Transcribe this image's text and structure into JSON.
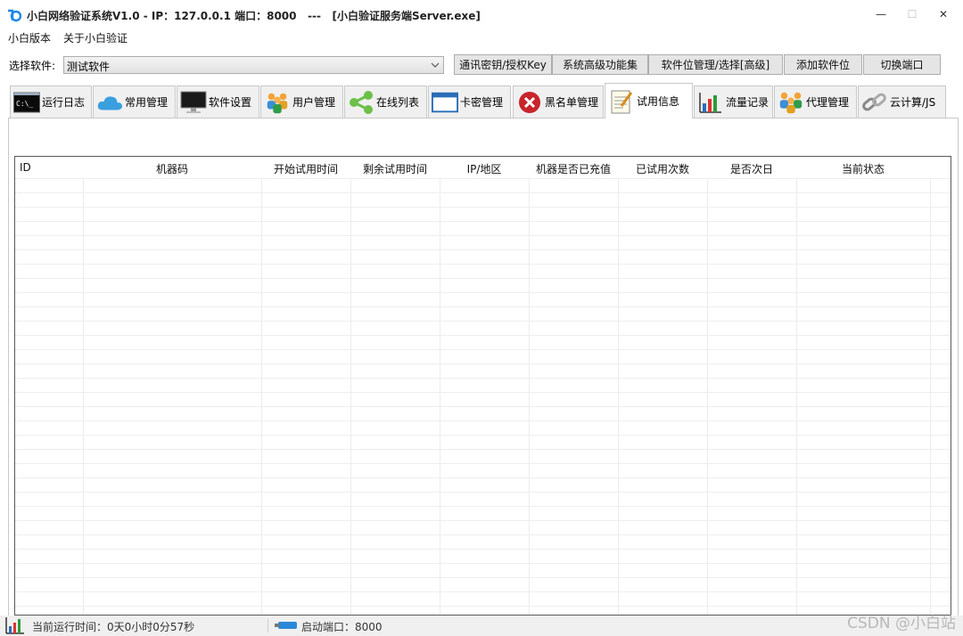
{
  "window": {
    "title": "小白网络验证系统V1.0 - IP：127.0.0.1 端口：8000   ---   [小白验证服务端Server.exe]",
    "minimize": "—",
    "maximize": "☐",
    "close": "✕"
  },
  "menu": {
    "items": [
      "小白版本",
      "关于小白验证"
    ]
  },
  "toolbar": {
    "select_label": "选择软件:",
    "select_value": "测试软件",
    "buttons": [
      "通讯密钥/授权Key",
      "系统高级功能集",
      "软件位管理/选择[高级]",
      "添加软件位",
      "切换端口"
    ]
  },
  "tabs": [
    {
      "label": "运行日志",
      "icon": "console-icon"
    },
    {
      "label": "常用管理",
      "icon": "cloud-icon"
    },
    {
      "label": "软件设置",
      "icon": "monitor-icon"
    },
    {
      "label": "用户管理",
      "icon": "users-icon"
    },
    {
      "label": "在线列表",
      "icon": "share-icon"
    },
    {
      "label": "卡密管理",
      "icon": "window-icon"
    },
    {
      "label": "黑名单管理",
      "icon": "blocked-icon"
    },
    {
      "label": "试用信息",
      "icon": "notepad-icon",
      "active": true
    },
    {
      "label": "流量记录",
      "icon": "bar-chart-icon"
    },
    {
      "label": "代理管理",
      "icon": "agents-icon"
    },
    {
      "label": "云计算/JS",
      "icon": "link-icon"
    }
  ],
  "table": {
    "columns": [
      "ID",
      "机器码",
      "开始试用时间",
      "剩余试用时间",
      "IP/地区",
      "机器是否已充值",
      "已试用次数",
      "是否次日",
      "当前状态"
    ],
    "rows": []
  },
  "status": {
    "runtime": "当前运行时间：0天0小时0分57秒",
    "port": "启动端口：8000"
  },
  "watermark": "CSDN @小白站",
  "colors": {
    "accent": "#1e88e5",
    "window_bg": "#f0f0f0",
    "button_bg": "#e5e5e5",
    "border": "#adadad"
  }
}
